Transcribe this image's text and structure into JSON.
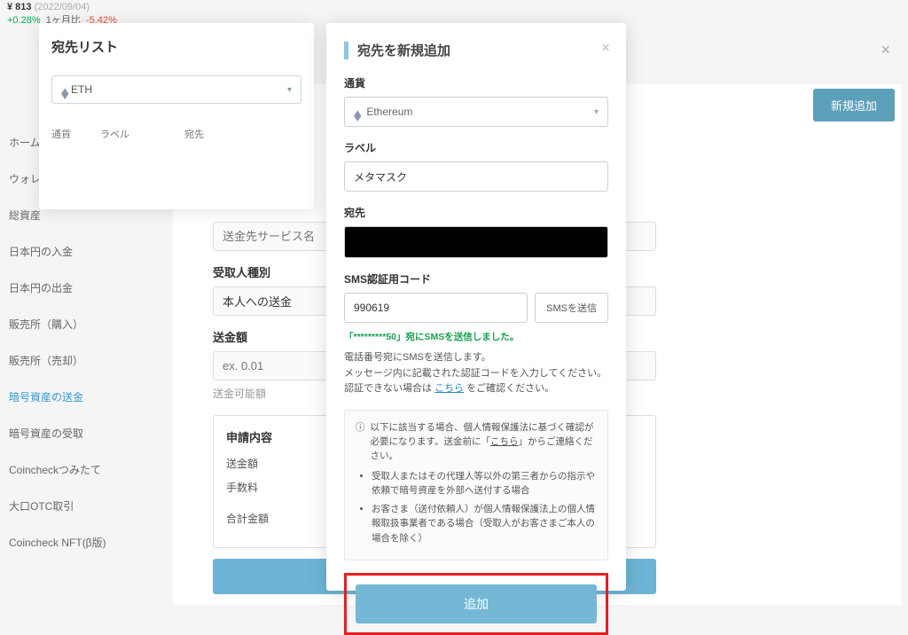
{
  "ticker": {
    "price": "¥ 813",
    "date": "(2022/09/04)",
    "change": "+0.28%",
    "period_label": "1ヶ月比",
    "period_change": "-5.42%"
  },
  "sidebar": {
    "items": [
      {
        "label": "ホーム"
      },
      {
        "label": "ウォレ"
      },
      {
        "label": "総資産"
      },
      {
        "label": "日本円の入金"
      },
      {
        "label": "日本円の出金"
      },
      {
        "label": "販売所（購入）"
      },
      {
        "label": "販売所（売却）"
      },
      {
        "label": "暗号資産の送金"
      },
      {
        "label": "暗号資産の受取"
      },
      {
        "label": "Coincheckつみたて"
      },
      {
        "label": "大口OTC取引"
      },
      {
        "label": "Coincheck NFT(β版)"
      }
    ]
  },
  "new_button": "新規追加",
  "bg_close": "×",
  "bg_form": {
    "service_ph": "送金先サービス名",
    "recipient_type_label": "受取人種別",
    "recipient_type_value": "本人への送金",
    "amount_label": "送金額",
    "amount_ph": "ex. 0.01",
    "available_label": "送金可能額",
    "summary_title": "申請内容",
    "row1": "送金額",
    "row2": "手数料",
    "row3": "合計金額"
  },
  "modal_left": {
    "title": "宛先リスト",
    "currency": "ETH",
    "col1": "通貨",
    "col2": "ラベル",
    "col3": "宛先"
  },
  "modal_main": {
    "title": "宛先を新規追加",
    "close": "×",
    "currency_label": "通貨",
    "currency_value": "Ethereum",
    "label_label": "ラベル",
    "label_value": "メタマスク",
    "address_label": "宛先",
    "sms_label": "SMS認証用コード",
    "sms_value": "990619",
    "sms_button": "SMSを送信",
    "sms_sent": "「*********50」宛にSMSを送信しました。",
    "sms_help1": "電話番号宛にSMSを送信します。",
    "sms_help2": "メッセージ内に記載された認証コードを入力してください。",
    "sms_help3a": "認証できない場合は",
    "sms_help3_link": "こちら",
    "sms_help3b": "をご確認ください。",
    "notice_head": "以下に該当する場合、個人情報保護法に基づく確認が必要になります。送金前に「",
    "notice_head_link": "こちら",
    "notice_head2": "」からご連絡ください。",
    "notice_li1": "受取人またはその代理人等以外の第三者からの指示や依頼で暗号資産を外部へ送付する場合",
    "notice_li2": "お客さま（送付依頼人）が個人情報保護法上の個人情報取扱事業者である場合（受取人がお客さまご本人の場合を除く）",
    "submit": "追加"
  }
}
